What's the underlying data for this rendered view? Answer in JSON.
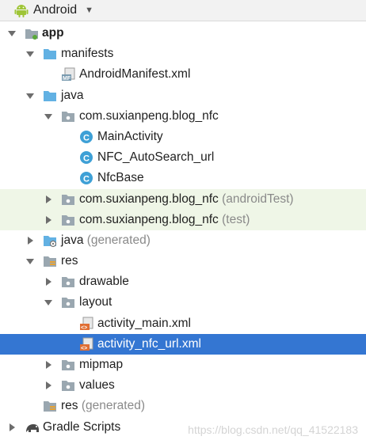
{
  "header": {
    "title": "Android",
    "caret": "▼"
  },
  "tree": [
    {
      "label": "app",
      "bold": true
    },
    {
      "label": "manifests"
    },
    {
      "label": "AndroidManifest.xml",
      "badge": "MF"
    },
    {
      "label": "java"
    },
    {
      "label": "com.suxianpeng.blog_nfc"
    },
    {
      "label": "MainActivity",
      "badge": "C"
    },
    {
      "label": "NFC_AutoSearch_url",
      "badge": "C"
    },
    {
      "label": "NfcBase",
      "badge": "C"
    },
    {
      "label": "com.suxianpeng.blog_nfc",
      "suffix": "(androidTest)"
    },
    {
      "label": "com.suxianpeng.blog_nfc",
      "suffix": "(test)"
    },
    {
      "label": "java",
      "suffix": "(generated)"
    },
    {
      "label": "res"
    },
    {
      "label": "drawable"
    },
    {
      "label": "layout"
    },
    {
      "label": "activity_main.xml",
      "badge": "<>"
    },
    {
      "label": "activity_nfc_url.xml",
      "badge": "<>"
    },
    {
      "label": "mipmap"
    },
    {
      "label": "values"
    },
    {
      "label": "res",
      "suffix": "(generated)"
    },
    {
      "label": "Gradle Scripts"
    }
  ],
  "watermark": "https://blog.csdn.net/qq_41522183",
  "colors": {
    "selection": "#3476d2",
    "test_row_bg": "#eff6e7",
    "folder_blue": "#62b1e3",
    "package_gray": "#9aa7b0",
    "class_badge": "#3ea0d6",
    "android_green": "#9fc537"
  }
}
